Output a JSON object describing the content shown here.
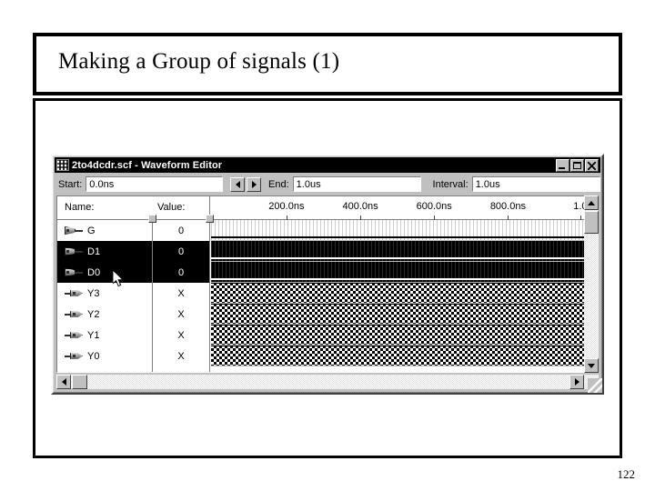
{
  "slide": {
    "title": "Making a Group of signals (1)",
    "page_number": "122"
  },
  "window": {
    "title": "2to4dcdr.scf - Waveform Editor",
    "icon": "waveform-editor-icon",
    "controls": {
      "minimize": "Minimize",
      "maximize": "Maximize",
      "close": "Close"
    },
    "toolbar": {
      "start_label": "Start:",
      "start_value": "0.0ns",
      "prev_button": "◄",
      "next_button": "►",
      "end_label": "End:",
      "end_value": "1.0us",
      "interval_label": "Interval:",
      "interval_value": "1.0us"
    },
    "headers": {
      "name": "Name:",
      "value": "Value:"
    },
    "ruler": {
      "ticks": [
        {
          "label": "200.0ns",
          "pos_pct": 19.5
        },
        {
          "label": "400.0ns",
          "pos_pct": 38.6
        },
        {
          "label": "600.0ns",
          "pos_pct": 57.7
        },
        {
          "label": "800.0ns",
          "pos_pct": 76.8
        },
        {
          "label": "1.0",
          "pos_pct": 95.5
        }
      ]
    },
    "signals": [
      {
        "name": "G",
        "value": "0",
        "pin": "input",
        "selected": false,
        "wave": "low"
      },
      {
        "name": "D1",
        "value": "0",
        "pin": "input",
        "selected": true,
        "wave": "low"
      },
      {
        "name": "D0",
        "value": "0",
        "pin": "input",
        "selected": true,
        "wave": "low"
      },
      {
        "name": "Y3",
        "value": "X",
        "pin": "output",
        "selected": false,
        "wave": "unknown"
      },
      {
        "name": "Y2",
        "value": "X",
        "pin": "output",
        "selected": false,
        "wave": "unknown"
      },
      {
        "name": "Y1",
        "value": "X",
        "pin": "output",
        "selected": false,
        "wave": "unknown"
      },
      {
        "name": "Y0",
        "value": "X",
        "pin": "output",
        "selected": false,
        "wave": "unknown"
      }
    ],
    "scrollbars": {
      "v_up": "Scroll up",
      "v_down": "Scroll down",
      "h_left": "Scroll left",
      "h_right": "Scroll right"
    }
  }
}
